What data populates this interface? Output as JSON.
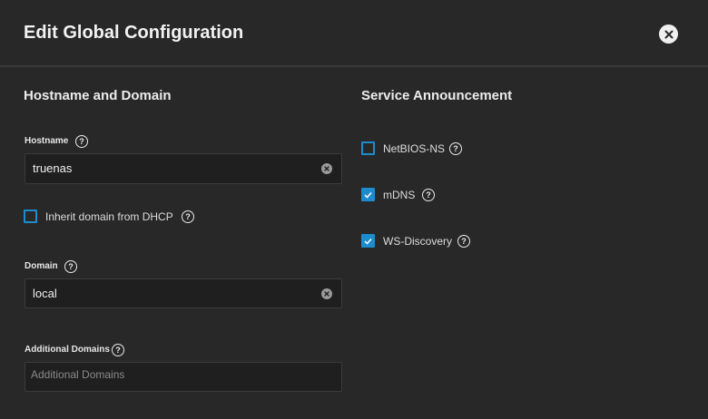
{
  "dialog": {
    "title": "Edit Global Configuration",
    "close_icon": "close-icon"
  },
  "hostname_section": {
    "title": "Hostname and Domain",
    "hostname": {
      "label": "Hostname",
      "value": "truenas"
    },
    "inherit_dhcp": {
      "label": "Inherit domain from DHCP",
      "checked": false
    },
    "domain": {
      "label": "Domain",
      "value": "local"
    },
    "additional_domains": {
      "label": "Additional Domains",
      "value": "",
      "placeholder": "Additional Domains"
    }
  },
  "service_section": {
    "title": "Service Announcement",
    "items": [
      {
        "label": "NetBIOS-NS",
        "checked": false
      },
      {
        "label": "mDNS",
        "checked": true
      },
      {
        "label": "WS-Discovery",
        "checked": true
      }
    ]
  },
  "colors": {
    "accent": "#1c8cce",
    "background": "#282828",
    "input_bg": "#1f1f1f"
  }
}
